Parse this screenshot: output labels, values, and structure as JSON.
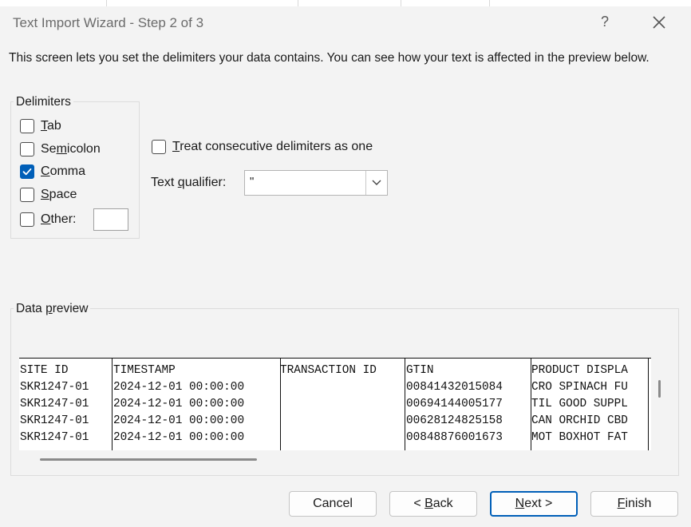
{
  "window": {
    "title": "Text Import Wizard - Step 2 of 3",
    "help_label": "?"
  },
  "intro": "This screen lets you set the delimiters your data contains.  You can see how your text is affected in the preview below.",
  "delimiters": {
    "title": "Delimiters",
    "tab": {
      "pre": "",
      "key": "T",
      "post": "ab",
      "checked": false
    },
    "semicolon": {
      "pre": "Se",
      "key": "m",
      "post": "icolon",
      "checked": false
    },
    "comma": {
      "pre": "",
      "key": "C",
      "post": "omma",
      "checked": true
    },
    "space": {
      "pre": "",
      "key": "S",
      "post": "pace",
      "checked": false
    },
    "other": {
      "pre": "",
      "key": "O",
      "post": "ther:",
      "checked": false,
      "value": ""
    }
  },
  "consecutive": {
    "pre": "",
    "key": "T",
    "post": "reat consecutive delimiters as one",
    "checked": false
  },
  "text_qualifier": {
    "pre": "Text ",
    "key": "q",
    "post": "ualifier:",
    "value": "\""
  },
  "preview": {
    "title_pre": "Data ",
    "title_key": "p",
    "title_post": "review",
    "columns": [
      {
        "header": "SITE ID",
        "cells": [
          "SKR1247-01",
          "SKR1247-01",
          "SKR1247-01",
          "SKR1247-01"
        ]
      },
      {
        "header": "TIMESTAMP",
        "cells": [
          "2024-12-01 00:00:00",
          "2024-12-01 00:00:00",
          "2024-12-01 00:00:00",
          "2024-12-01 00:00:00"
        ]
      },
      {
        "header": "TRANSACTION ID",
        "cells": [
          "",
          "",
          "",
          ""
        ]
      },
      {
        "header": "GTIN",
        "cells": [
          "00841432015084",
          "00694144005177",
          "00628124825158",
          "00848876001673"
        ]
      },
      {
        "header": "PRODUCT DISPLA",
        "cells": [
          "CRO SPINACH FU",
          "TIL GOOD SUPPL",
          "CAN ORCHID CBD",
          "MOT BOXHOT FAT"
        ]
      }
    ]
  },
  "buttons": {
    "cancel": {
      "pre": "Cancel",
      "key": "",
      "post": ""
    },
    "back": {
      "pre": "< ",
      "key": "B",
      "post": "ack"
    },
    "next": {
      "pre": "",
      "key": "N",
      "post": "ext >"
    },
    "finish": {
      "pre": "",
      "key": "F",
      "post": "inish"
    }
  },
  "colors": {
    "accent": "#005fb8",
    "dialog_bg": "#f3f3f3",
    "preview_bg": "#ffffff"
  },
  "icons": {
    "close": "close-icon",
    "checkmark": "checkmark-icon",
    "dropdown": "chevron-down-icon"
  }
}
